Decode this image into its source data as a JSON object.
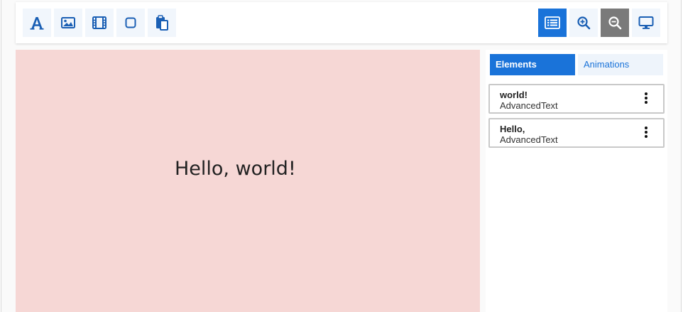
{
  "toolbar": {
    "left_buttons": [
      {
        "name": "text-icon"
      },
      {
        "name": "image-icon"
      },
      {
        "name": "video-icon"
      },
      {
        "name": "shape-icon"
      },
      {
        "name": "paste-icon"
      }
    ],
    "right_buttons": [
      {
        "name": "list-icon",
        "state": "active"
      },
      {
        "name": "zoom-in-icon"
      },
      {
        "name": "zoom-out-icon",
        "state": "disabled"
      },
      {
        "name": "monitor-icon"
      }
    ]
  },
  "canvas": {
    "background": "#f6d7d5",
    "text": "Hello, world!"
  },
  "panel": {
    "tabs": [
      {
        "label": "Elements",
        "active": true
      },
      {
        "label": "Animations",
        "active": false
      }
    ],
    "elements": [
      {
        "title": "world!",
        "type": "AdvancedText"
      },
      {
        "title": "Hello,",
        "type": "AdvancedText"
      }
    ]
  },
  "colors": {
    "accent": "#1a73d9",
    "disabled": "#7a7a7a",
    "button_bg": "#f1f6fc"
  }
}
